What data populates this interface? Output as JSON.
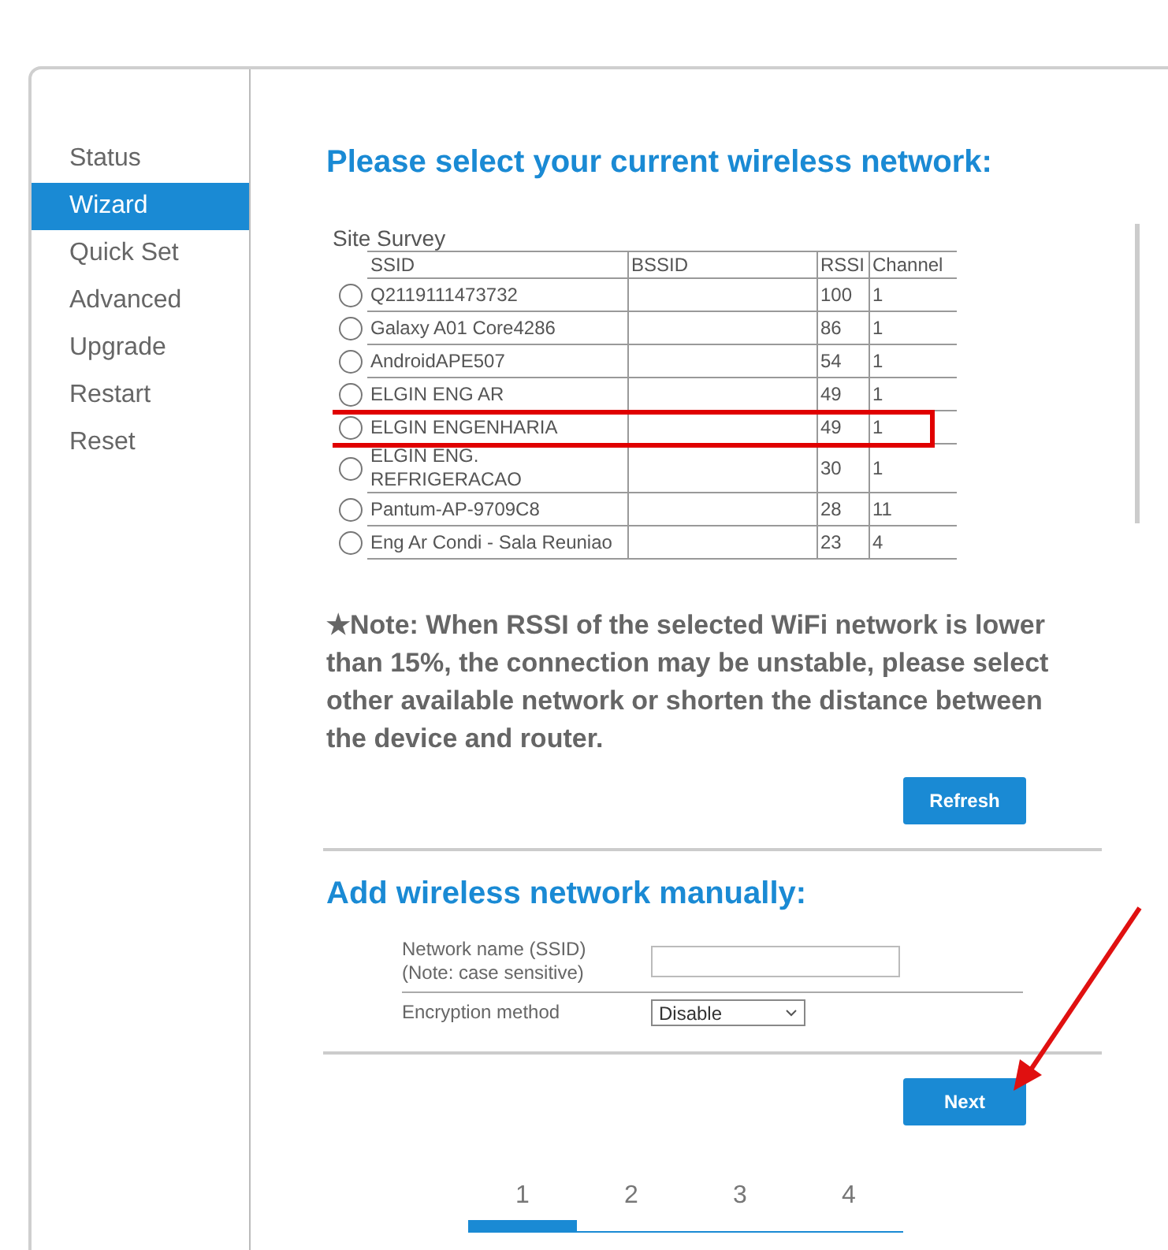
{
  "sidebar": {
    "items": [
      {
        "label": "Status",
        "selected": false
      },
      {
        "label": "Wizard",
        "selected": true
      },
      {
        "label": "Quick Set",
        "selected": false
      },
      {
        "label": "Advanced",
        "selected": false
      },
      {
        "label": "Upgrade",
        "selected": false
      },
      {
        "label": "Restart",
        "selected": false
      },
      {
        "label": "Reset",
        "selected": false
      }
    ]
  },
  "heading": "Please select your current wireless network:",
  "site_survey": {
    "caption": "Site Survey",
    "columns": [
      "SSID",
      "BSSID",
      "RSSI",
      "Channel"
    ],
    "rows": [
      {
        "ssid": "Q2119111473732",
        "rssi": "100",
        "channel": "1",
        "selected": false,
        "highlighted": false
      },
      {
        "ssid": "Galaxy A01 Core4286",
        "rssi": "86",
        "channel": "1",
        "selected": false,
        "highlighted": false
      },
      {
        "ssid": "AndroidAPE507",
        "rssi": "54",
        "channel": "1",
        "selected": false,
        "highlighted": false
      },
      {
        "ssid": "ELGIN ENG AR",
        "rssi": "49",
        "channel": "1",
        "selected": false,
        "highlighted": false
      },
      {
        "ssid": "ELGIN ENGENHARIA",
        "rssi": "49",
        "channel": "1",
        "selected": false,
        "highlighted": true
      },
      {
        "ssid": "ELGIN ENG. REFRIGERACAO",
        "rssi": "30",
        "channel": "1",
        "selected": false,
        "highlighted": false
      },
      {
        "ssid": "Pantum-AP-9709C8",
        "rssi": "28",
        "channel": "11",
        "selected": false,
        "highlighted": false
      },
      {
        "ssid": "Eng Ar Condi - Sala Reuniao",
        "rssi": "23",
        "channel": "4",
        "selected": false,
        "highlighted": false
      }
    ]
  },
  "note": "★Note: When RSSI of the selected WiFi network is lower than 15%, the connection may be unstable, please select other available network or shorten the distance between the device and router.",
  "refresh_button": "Refresh",
  "manual": {
    "heading": "Add wireless network manually:",
    "fields": [
      {
        "kind": "text",
        "label": "Network name (SSID)\n(Note: case sensitive)"
      },
      {
        "kind": "select",
        "label": "Encryption method",
        "value": "Disable"
      }
    ]
  },
  "next_button": "Next",
  "steps": [
    {
      "label": "1",
      "selected": true
    },
    {
      "label": "2",
      "selected": false
    },
    {
      "label": "3",
      "selected": false
    },
    {
      "label": "4",
      "selected": false
    }
  ]
}
